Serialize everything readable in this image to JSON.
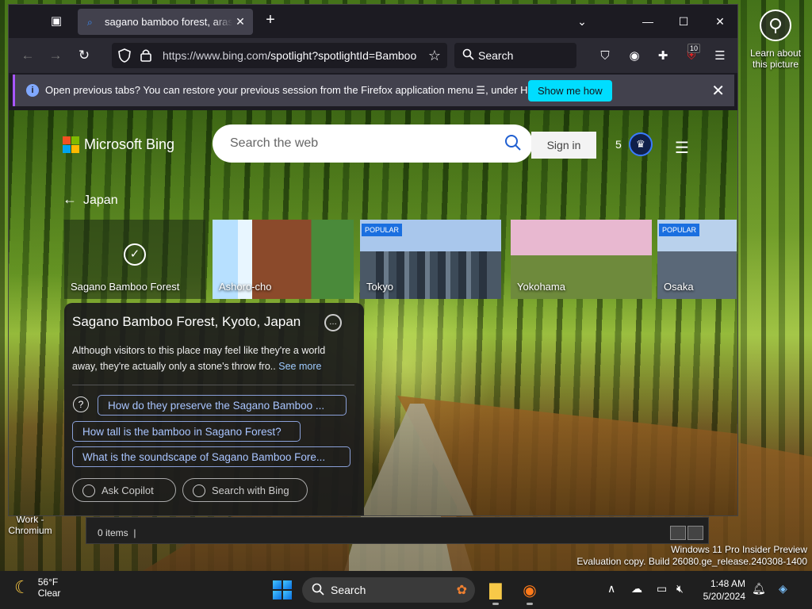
{
  "desktop": {
    "learn_label": "Learn about this picture",
    "work_label": "Work - Chromium",
    "watermark_line1": "Windows 11 Pro Insider Preview",
    "watermark_line2": "Evaluation copy. Build 26080.ge_release.240308-1400"
  },
  "explorer": {
    "items_count": "0 items"
  },
  "browser": {
    "tab_title": "sagano bamboo forest, arashiyama",
    "url_host": "https://www.bing.com",
    "url_path": "/spotlight?spotlightId=BambooForest",
    "search_placeholder": "Search",
    "ext_badge": "10",
    "notification": {
      "message": "Open previous tabs? You can restore your previous session from the Firefox application menu ☰, under History.",
      "button": "Show me how"
    }
  },
  "bing": {
    "logo_text": "Microsoft Bing",
    "search_placeholder": "Search the web",
    "sign_in": "Sign in",
    "rewards_count": "5",
    "back_label": "Japan",
    "cards": [
      {
        "label": "Sagano Bamboo Forest",
        "badge": ""
      },
      {
        "label": "Ashoro-cho",
        "badge": ""
      },
      {
        "label": "Tokyo",
        "badge": "POPULAR"
      },
      {
        "label": "Yokohama",
        "badge": ""
      },
      {
        "label": "Osaka",
        "badge": "POPULAR"
      }
    ],
    "panel": {
      "title": "Sagano Bamboo Forest, Kyoto, Japan",
      "description": "Although visitors to this place may feel like they're a world away, they're actually only a stone's throw fro..",
      "see_more": "See more",
      "questions": [
        "How do they preserve the Sagano Bamboo ...",
        "How tall is the bamboo in Sagano Forest?",
        "What is the soundscape of Sagano Bamboo Fore..."
      ],
      "ask_copilot": "Ask Copilot",
      "search_bing": "Search with Bing"
    }
  },
  "taskbar": {
    "temp": "56°F",
    "condition": "Clear",
    "search": "Search",
    "time": "1:48 AM",
    "date": "5/20/2024"
  },
  "colors": {
    "accent": "#00ddff",
    "bing_blue": "#1f5fd1",
    "popular_badge": "#1a6fe0"
  }
}
